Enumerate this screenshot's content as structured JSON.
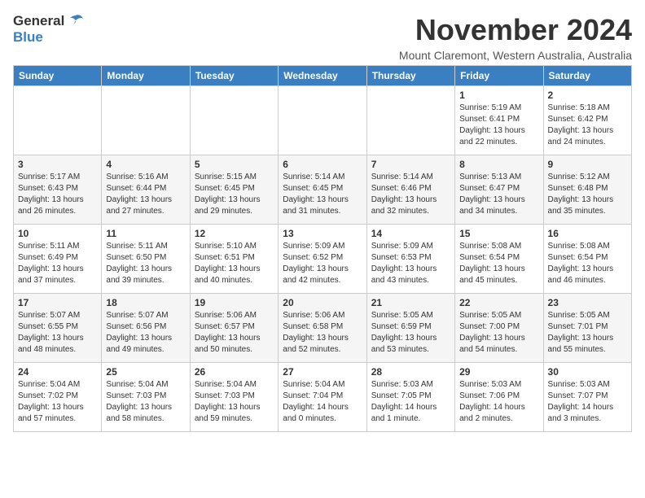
{
  "title": "November 2024",
  "location": "Mount Claremont, Western Australia, Australia",
  "logo": {
    "general": "General",
    "blue": "Blue"
  },
  "weekdays": [
    "Sunday",
    "Monday",
    "Tuesday",
    "Wednesday",
    "Thursday",
    "Friday",
    "Saturday"
  ],
  "weeks": [
    [
      {
        "day": "",
        "info": ""
      },
      {
        "day": "",
        "info": ""
      },
      {
        "day": "",
        "info": ""
      },
      {
        "day": "",
        "info": ""
      },
      {
        "day": "",
        "info": ""
      },
      {
        "day": "1",
        "info": "Sunrise: 5:19 AM\nSunset: 6:41 PM\nDaylight: 13 hours\nand 22 minutes."
      },
      {
        "day": "2",
        "info": "Sunrise: 5:18 AM\nSunset: 6:42 PM\nDaylight: 13 hours\nand 24 minutes."
      }
    ],
    [
      {
        "day": "3",
        "info": "Sunrise: 5:17 AM\nSunset: 6:43 PM\nDaylight: 13 hours\nand 26 minutes."
      },
      {
        "day": "4",
        "info": "Sunrise: 5:16 AM\nSunset: 6:44 PM\nDaylight: 13 hours\nand 27 minutes."
      },
      {
        "day": "5",
        "info": "Sunrise: 5:15 AM\nSunset: 6:45 PM\nDaylight: 13 hours\nand 29 minutes."
      },
      {
        "day": "6",
        "info": "Sunrise: 5:14 AM\nSunset: 6:45 PM\nDaylight: 13 hours\nand 31 minutes."
      },
      {
        "day": "7",
        "info": "Sunrise: 5:14 AM\nSunset: 6:46 PM\nDaylight: 13 hours\nand 32 minutes."
      },
      {
        "day": "8",
        "info": "Sunrise: 5:13 AM\nSunset: 6:47 PM\nDaylight: 13 hours\nand 34 minutes."
      },
      {
        "day": "9",
        "info": "Sunrise: 5:12 AM\nSunset: 6:48 PM\nDaylight: 13 hours\nand 35 minutes."
      }
    ],
    [
      {
        "day": "10",
        "info": "Sunrise: 5:11 AM\nSunset: 6:49 PM\nDaylight: 13 hours\nand 37 minutes."
      },
      {
        "day": "11",
        "info": "Sunrise: 5:11 AM\nSunset: 6:50 PM\nDaylight: 13 hours\nand 39 minutes."
      },
      {
        "day": "12",
        "info": "Sunrise: 5:10 AM\nSunset: 6:51 PM\nDaylight: 13 hours\nand 40 minutes."
      },
      {
        "day": "13",
        "info": "Sunrise: 5:09 AM\nSunset: 6:52 PM\nDaylight: 13 hours\nand 42 minutes."
      },
      {
        "day": "14",
        "info": "Sunrise: 5:09 AM\nSunset: 6:53 PM\nDaylight: 13 hours\nand 43 minutes."
      },
      {
        "day": "15",
        "info": "Sunrise: 5:08 AM\nSunset: 6:54 PM\nDaylight: 13 hours\nand 45 minutes."
      },
      {
        "day": "16",
        "info": "Sunrise: 5:08 AM\nSunset: 6:54 PM\nDaylight: 13 hours\nand 46 minutes."
      }
    ],
    [
      {
        "day": "17",
        "info": "Sunrise: 5:07 AM\nSunset: 6:55 PM\nDaylight: 13 hours\nand 48 minutes."
      },
      {
        "day": "18",
        "info": "Sunrise: 5:07 AM\nSunset: 6:56 PM\nDaylight: 13 hours\nand 49 minutes."
      },
      {
        "day": "19",
        "info": "Sunrise: 5:06 AM\nSunset: 6:57 PM\nDaylight: 13 hours\nand 50 minutes."
      },
      {
        "day": "20",
        "info": "Sunrise: 5:06 AM\nSunset: 6:58 PM\nDaylight: 13 hours\nand 52 minutes."
      },
      {
        "day": "21",
        "info": "Sunrise: 5:05 AM\nSunset: 6:59 PM\nDaylight: 13 hours\nand 53 minutes."
      },
      {
        "day": "22",
        "info": "Sunrise: 5:05 AM\nSunset: 7:00 PM\nDaylight: 13 hours\nand 54 minutes."
      },
      {
        "day": "23",
        "info": "Sunrise: 5:05 AM\nSunset: 7:01 PM\nDaylight: 13 hours\nand 55 minutes."
      }
    ],
    [
      {
        "day": "24",
        "info": "Sunrise: 5:04 AM\nSunset: 7:02 PM\nDaylight: 13 hours\nand 57 minutes."
      },
      {
        "day": "25",
        "info": "Sunrise: 5:04 AM\nSunset: 7:03 PM\nDaylight: 13 hours\nand 58 minutes."
      },
      {
        "day": "26",
        "info": "Sunrise: 5:04 AM\nSunset: 7:03 PM\nDaylight: 13 hours\nand 59 minutes."
      },
      {
        "day": "27",
        "info": "Sunrise: 5:04 AM\nSunset: 7:04 PM\nDaylight: 14 hours\nand 0 minutes."
      },
      {
        "day": "28",
        "info": "Sunrise: 5:03 AM\nSunset: 7:05 PM\nDaylight: 14 hours\nand 1 minute."
      },
      {
        "day": "29",
        "info": "Sunrise: 5:03 AM\nSunset: 7:06 PM\nDaylight: 14 hours\nand 2 minutes."
      },
      {
        "day": "30",
        "info": "Sunrise: 5:03 AM\nSunset: 7:07 PM\nDaylight: 14 hours\nand 3 minutes."
      }
    ]
  ]
}
